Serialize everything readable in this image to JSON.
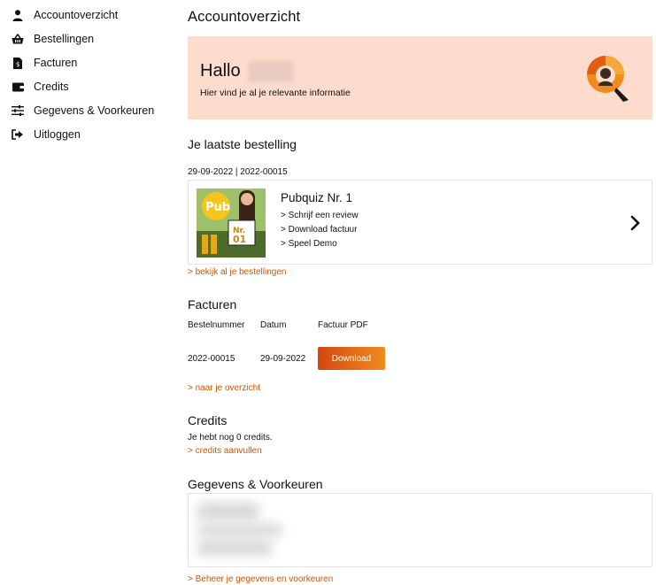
{
  "sidebar": {
    "items": [
      {
        "label": "Accountoverzicht",
        "icon": "user-icon"
      },
      {
        "label": "Bestellingen",
        "icon": "basket-icon"
      },
      {
        "label": "Facturen",
        "icon": "invoice-icon"
      },
      {
        "label": "Credits",
        "icon": "wallet-icon"
      },
      {
        "label": "Gegevens & Voorkeuren",
        "icon": "sliders-icon"
      },
      {
        "label": "Uitloggen",
        "icon": "logout-icon"
      }
    ]
  },
  "main": {
    "title": "Accountoverzicht",
    "hero": {
      "greeting": "Hallo",
      "subtitle": "Hier vind je al je relevante informatie"
    },
    "latest_order": {
      "heading": "Je laatste bestelling",
      "meta": "29-09-2022 | 2022-00015",
      "product_title": "Pubquiz Nr. 1",
      "links": [
        "> Schrijf een review",
        "> Download factuur",
        "> Speel Demo"
      ],
      "view_all": "> bekijk al je bestellingen"
    },
    "invoices": {
      "heading": "Facturen",
      "columns": [
        "Bestelnummer",
        "Datum",
        "Factuur PDF"
      ],
      "rows": [
        {
          "order_number": "2022-00015",
          "date": "29-09-2022",
          "button": "Download"
        }
      ],
      "overview_link": "> naar je overzicht"
    },
    "credits": {
      "heading": "Credits",
      "text": "Je hebt nog 0 credits.",
      "topup_link": "> credits aanvullen"
    },
    "preferences": {
      "heading": "Gegevens & Voorkeuren",
      "manage_link": "> Beheer je gegevens en voorkeuren"
    }
  },
  "colors": {
    "accent": "#d35400",
    "hero_bg": "#fddccd",
    "button_start": "#d4470e",
    "button_end": "#f08c1f"
  }
}
